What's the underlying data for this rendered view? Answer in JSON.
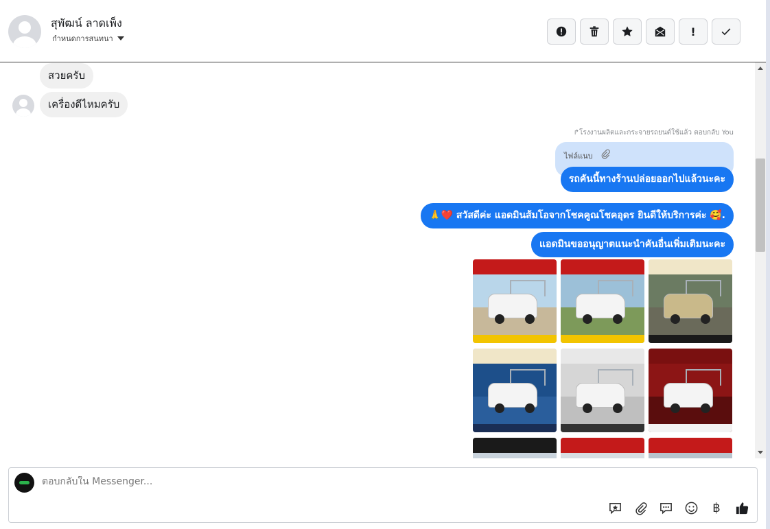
{
  "header": {
    "contact_name": "สุพัฒน์ ลาดเพ็ง",
    "assign_label": "กำหนดการสนทนา",
    "actions": [
      {
        "name": "spam-button",
        "icon": "alert-circle-icon"
      },
      {
        "name": "delete-button",
        "icon": "trash-icon"
      },
      {
        "name": "star-button",
        "icon": "star-icon"
      },
      {
        "name": "mark-unread-button",
        "icon": "envelope-icon"
      },
      {
        "name": "follow-up-button",
        "icon": "exclamation-icon",
        "glyph": "!"
      },
      {
        "name": "done-button",
        "icon": "check-icon"
      }
    ]
  },
  "messages": {
    "in_1": "สวยครับ",
    "in_2": "เครื่องดีไหมครับ",
    "reply_note": "↱โรงงานผลิตและกระจายรถยนต์ใช้แล้ว ตอบกลับ You",
    "attachment_label": "ไฟล์แนบ",
    "out_1": "รถคันนี้ทางร้านปล่อยออกไปแล้วนะคะ",
    "out_2": "🙏❤️ สวัสดีค่ะ แอดมินส้มโอจากโชคคูณโชคอุดร ยินดีให้บริการค่ะ  🥰.",
    "out_3": "แอดมินขออนุญาตแนะนำคันอื่นเพิ่มเติมนะคะ"
  },
  "colors": {
    "outgoing": "#1877f2",
    "incoming": "#f0f0f0",
    "attachment": "#cfe2fb"
  },
  "composer": {
    "placeholder": "ตอบกลับใน Messenger...",
    "value": "",
    "tools": [
      "saved-reply-icon",
      "paperclip-icon",
      "chat-bubbles-icon",
      "emoji-icon",
      "baht-icon",
      "thumbs-up-icon"
    ],
    "baht_glyph": "฿"
  }
}
